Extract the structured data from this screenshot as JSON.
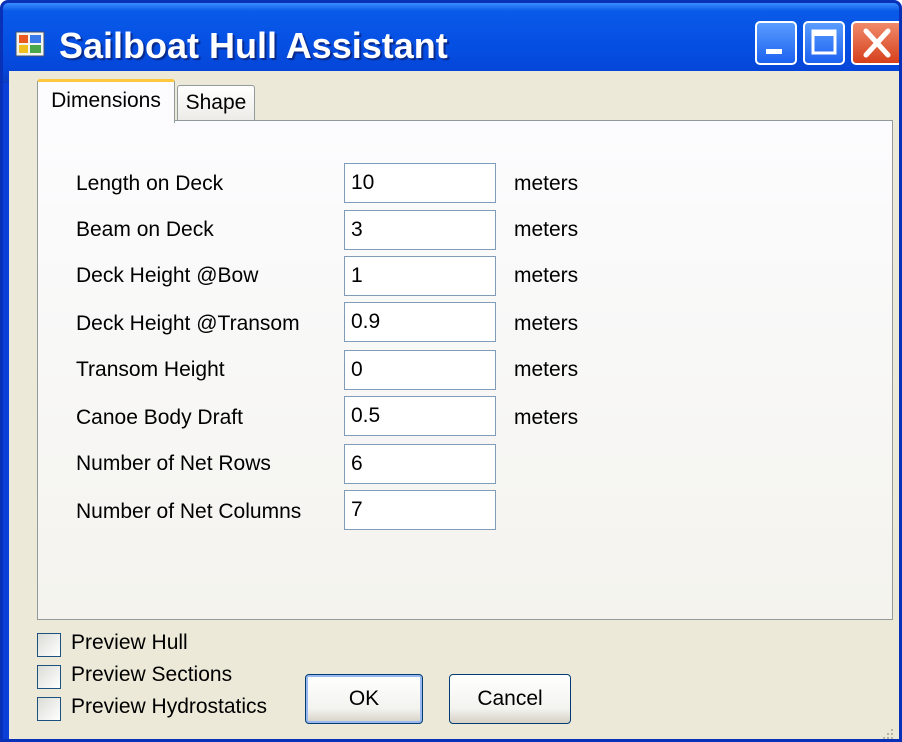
{
  "window": {
    "title": "Sailboat Hull Assistant",
    "controls": [
      "minimize",
      "maximize",
      "close"
    ]
  },
  "tabs": [
    {
      "label": "Dimensions",
      "active": true
    },
    {
      "label": "Shape",
      "active": false
    }
  ],
  "fields": [
    {
      "label": "Length on Deck",
      "value": "10",
      "unit": "meters"
    },
    {
      "label": "Beam on Deck",
      "value": "3",
      "unit": "meters"
    },
    {
      "label": "Deck Height @Bow",
      "value": "1",
      "unit": "meters"
    },
    {
      "label": "Deck Height @Transom",
      "value": "0.9",
      "unit": "meters"
    },
    {
      "label": "Transom Height",
      "value": "0",
      "unit": "meters"
    },
    {
      "label": "Canoe Body Draft",
      "value": "0.5",
      "unit": "meters"
    },
    {
      "label": "Number of Net Rows",
      "value": "6",
      "unit": ""
    },
    {
      "label": "Number of Net Columns",
      "value": "7",
      "unit": ""
    }
  ],
  "checkboxes": [
    {
      "label": "Preview Hull",
      "checked": false
    },
    {
      "label": "Preview Sections",
      "checked": false
    },
    {
      "label": "Preview Hydrostatics",
      "checked": false
    }
  ],
  "buttons": {
    "ok_label": "OK",
    "cancel_label": "Cancel"
  },
  "colors": {
    "title_bar": "#0550e4",
    "close_button": "#d6401c",
    "dialog_bg": "#ece9d8",
    "tab_accent": "#ffc83c"
  }
}
